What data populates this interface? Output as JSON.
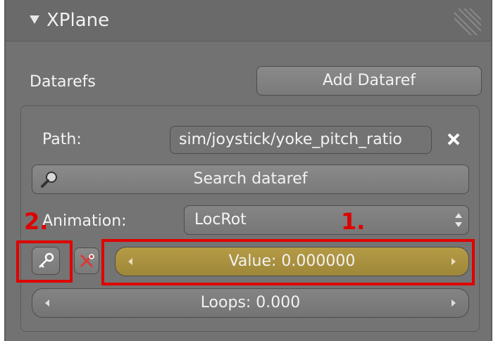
{
  "panel": {
    "title": "XPlane",
    "datarefs_label": "Datarefs",
    "add_button_label": "Add Dataref"
  },
  "dataref": {
    "path_label": "Path:",
    "path_value": "sim/joystick/yoke_pitch_ratio",
    "search_label": "Search dataref",
    "animation_label": "Animation:",
    "animation_value": "LocRot",
    "value_label": "Value: 0.000000",
    "loops_label": "Loops: 0.000"
  },
  "annotations": {
    "one": "1.",
    "two": "2."
  },
  "colors": {
    "value_slider": "#a8903c",
    "highlight": "#e00000"
  },
  "icons": [
    "disclosure-triangle-icon",
    "grip-icon",
    "close-icon",
    "search-icon",
    "key-icon",
    "unlink-icon",
    "up-down-arrows-icon",
    "left-arrow-icon",
    "right-arrow-icon"
  ]
}
